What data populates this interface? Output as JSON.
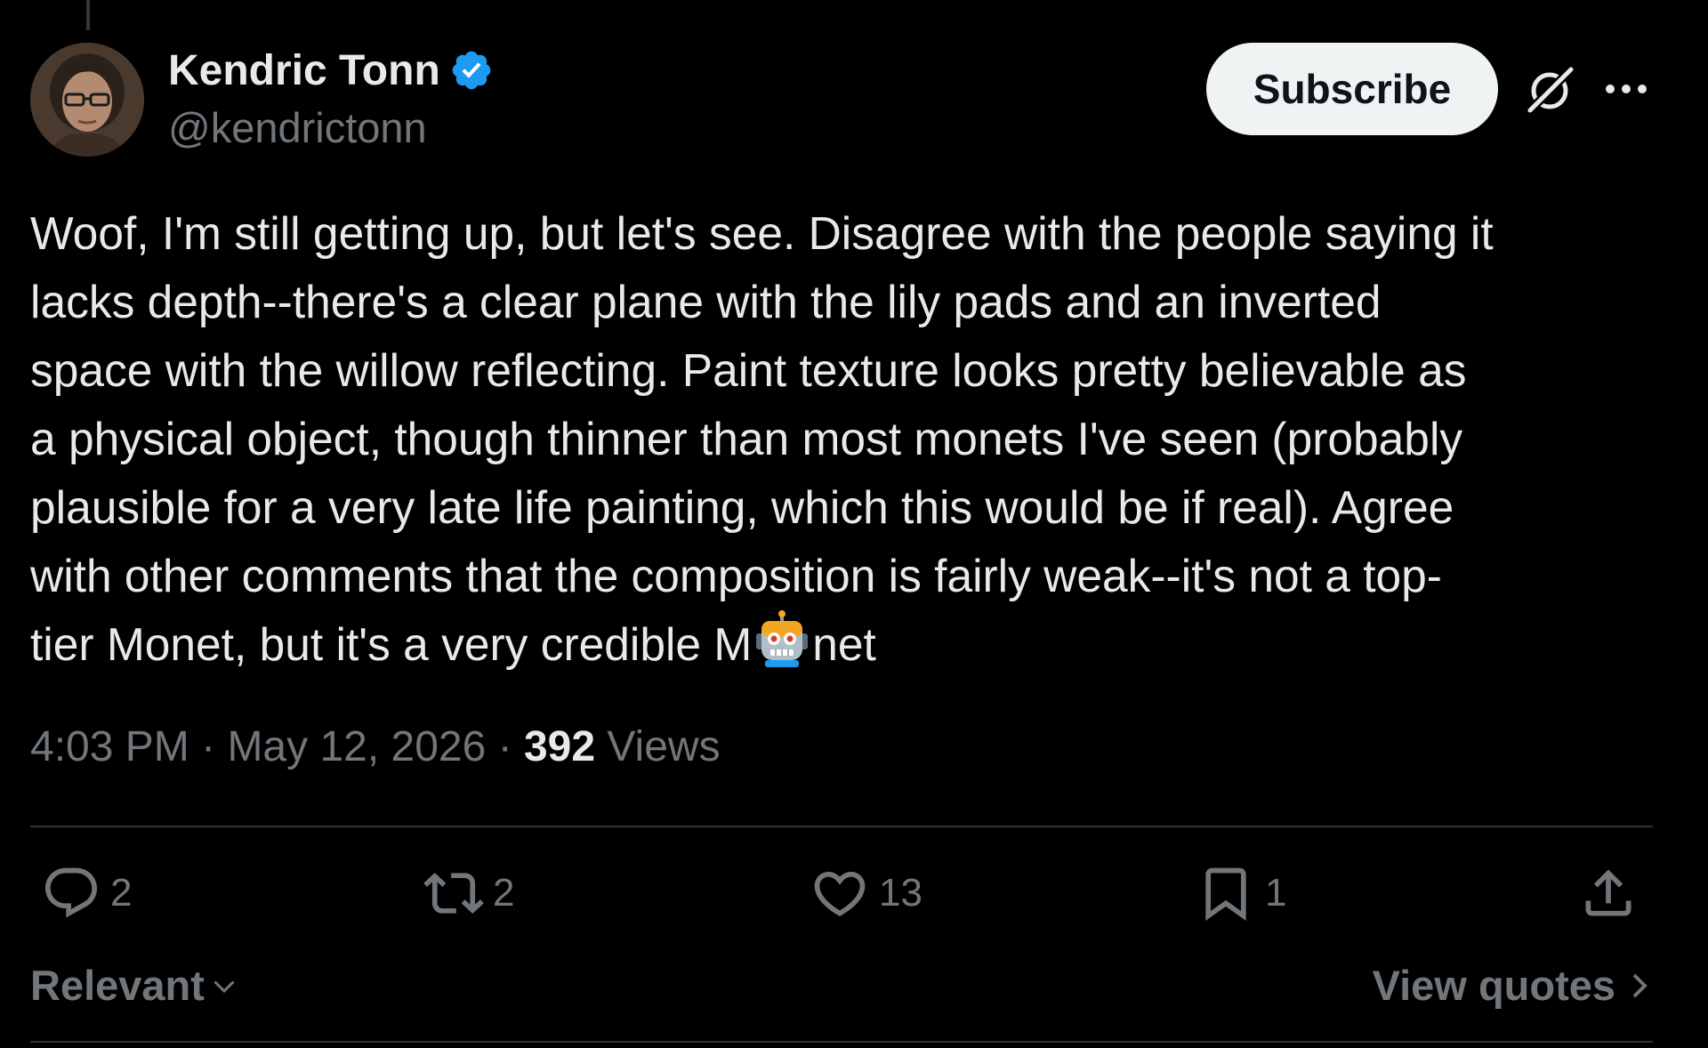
{
  "author": {
    "display_name": "Kendric Tonn",
    "handle": "@kendrictonn",
    "verified": true,
    "verified_color": "#1d9bf0"
  },
  "header": {
    "subscribe_label": "Subscribe",
    "grok_icon": "grok-icon",
    "more_icon": "more-icon"
  },
  "tweet": {
    "text_before_emoji": "Woof, I'm still getting up, but let's see. Disagree with the people saying it\nlacks depth--there's a clear plane with the lily pads and an inverted\nspace with the willow reflecting.  Paint texture looks pretty believable as\na physical object, though thinner than most monets I've seen (probably\nplausible for a very late life painting, which this would be if real).  Agree\nwith other comments that the composition is fairly weak--it's not a top-\ntier Monet, but it's a very credible M",
    "emoji": "robot-face-emoji",
    "text_after_emoji": "net"
  },
  "meta": {
    "time": "4:03 PM",
    "separator": "·",
    "date": "May 12, 2026",
    "views_count": "392",
    "views_label": "Views"
  },
  "actions": [
    {
      "icon": "reply-icon",
      "count": "2"
    },
    {
      "icon": "retweet-icon",
      "count": "2"
    },
    {
      "icon": "like-icon",
      "count": "13"
    },
    {
      "icon": "bookmark-icon",
      "count": "1"
    },
    {
      "icon": "share-icon",
      "count": ""
    }
  ],
  "footer": {
    "sort_label": "Relevant",
    "view_quotes_label": "View quotes"
  },
  "colors": {
    "background": "#000000",
    "text_primary": "#e7e9ea",
    "text_secondary": "#71767b",
    "divider": "#2f3336",
    "button_bg": "#eff3f4"
  }
}
